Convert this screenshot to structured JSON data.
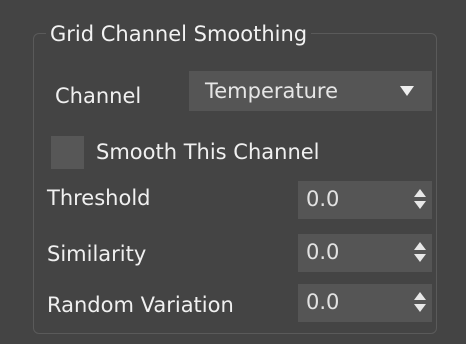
{
  "panel": {
    "title": "Grid Channel Smoothing"
  },
  "channel": {
    "label": "Channel",
    "selected": "Temperature"
  },
  "smooth": {
    "label": "Smooth This Channel",
    "checked": false
  },
  "threshold": {
    "label": "Threshold",
    "value": "0.0"
  },
  "similarity": {
    "label": "Similarity",
    "value": "0.0"
  },
  "random_variation": {
    "label": "Random Variation",
    "value": "0.0"
  },
  "icons": {
    "dropdown": "chevron-down-icon",
    "spinner": "spinner-arrows-icon"
  },
  "colors": {
    "background": "#444444",
    "field": "#555555",
    "text": "#f0f0f0"
  }
}
